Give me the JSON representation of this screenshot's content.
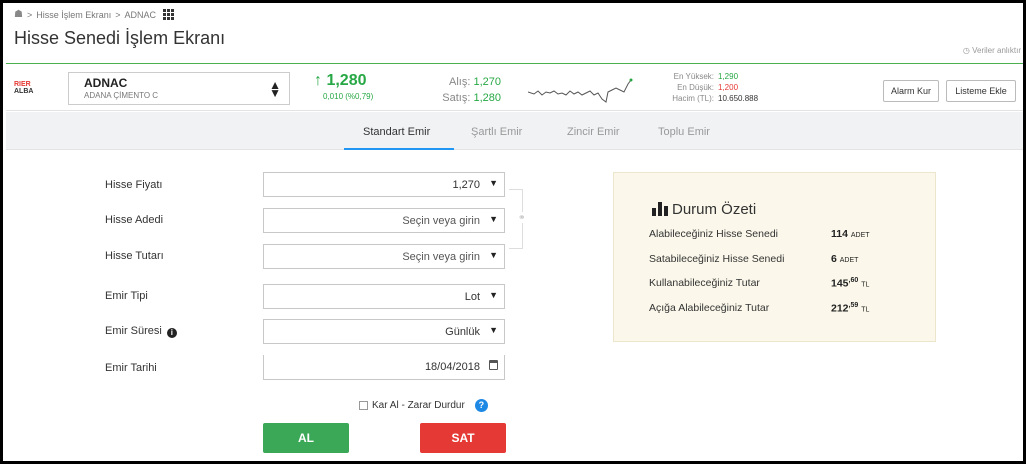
{
  "breadcrumb": {
    "items": [
      "Hisse İşlem Ekranı",
      "ADNAC"
    ],
    "separator": ">"
  },
  "page": {
    "title": "Hisse Senedi İşlem Ekranı",
    "data_note": "Veriler anlıktır"
  },
  "stock": {
    "code": "ADNAC",
    "name": "ADANA ÇİMENTO C",
    "price": "1,280",
    "change": "0,010  (%0,79)",
    "bid_label": "Alış:",
    "bid": "1,270",
    "ask_label": "Satış:",
    "ask": "1,280",
    "high_label": "En Yüksek:",
    "high": "1,290",
    "low_label": "En Düşük:",
    "low": "1,200",
    "volume_label": "Hacim (TL):",
    "volume": "10.650.888",
    "logo_text_top": "RIER",
    "logo_text_bottom": "ALBA"
  },
  "actions": {
    "alarm": "Alarm Kur",
    "watchlist": "Listeme Ekle"
  },
  "tabs": [
    {
      "label": "Standart Emir",
      "active": true
    },
    {
      "label": "Şartlı Emir",
      "active": false
    },
    {
      "label": "Zincir Emir",
      "active": false
    },
    {
      "label": "Toplu Emir",
      "active": false
    }
  ],
  "form": {
    "price": {
      "label": "Hisse Fiyatı",
      "value": "1,270"
    },
    "quantity": {
      "label": "Hisse Adedi",
      "value": "Seçin veya girin"
    },
    "amount": {
      "label": "Hisse Tutarı",
      "value": "Seçin veya girin"
    },
    "order_type": {
      "label": "Emir Tipi",
      "value": "Lot"
    },
    "duration": {
      "label": "Emir Süresi",
      "value": "Günlük"
    },
    "date": {
      "label": "Emir Tarihi",
      "value": "18/04/2018"
    },
    "stop_loss": {
      "label": "Kar Al - Zarar Durdur",
      "checked": false
    },
    "buy": "AL",
    "sell": "SAT"
  },
  "summary": {
    "title": "Durum Özeti",
    "rows": [
      {
        "label": "Alabileceğiniz Hisse Senedi",
        "value": "114",
        "unit": "ADET"
      },
      {
        "label": "Satabileceğiniz Hisse Senedi",
        "value": "6",
        "unit": "ADET"
      },
      {
        "label": "Kullanabileceğiniz Tutar",
        "value": "145",
        "decimals": ",60",
        "unit": "TL"
      },
      {
        "label": "Açığa Alabileceğiniz Tutar",
        "value": "212",
        "decimals": ",59",
        "unit": "TL"
      }
    ]
  },
  "colors": {
    "up": "#27a845",
    "down": "#e53935",
    "buy": "#3aa856",
    "sell": "#e53935",
    "accent": "#2196f3"
  },
  "icons": [
    "home-icon",
    "apps-grid-icon",
    "clock-icon",
    "sort-icon",
    "up-arrow-icon",
    "sparkline",
    "calendar-icon",
    "info-icon",
    "link-icon",
    "help-icon",
    "bar-chart-icon"
  ]
}
